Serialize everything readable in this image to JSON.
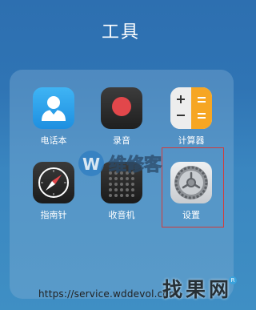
{
  "folder": {
    "title": "工具",
    "apps": [
      {
        "label": "电话本",
        "icon": "contacts-icon"
      },
      {
        "label": "录音",
        "icon": "recorder-icon"
      },
      {
        "label": "计算器",
        "icon": "calculator-icon"
      },
      {
        "label": "指南针",
        "icon": "compass-icon"
      },
      {
        "label": "收音机",
        "icon": "radio-icon"
      },
      {
        "label": "设置",
        "icon": "settings-icon"
      }
    ]
  },
  "highlight": {
    "color": "#d23b3b",
    "target": "设置"
  },
  "watermark": {
    "logo_text": "维修客",
    "brand": "找果网",
    "url": "https://service.wddevol.com"
  },
  "colors": {
    "background_top": "#2d6fb0",
    "background_bottom": "#3f8fc4",
    "contacts": "#2a9ee8",
    "recorder_dot": "#e2474b",
    "calc_orange": "#f6a623"
  }
}
